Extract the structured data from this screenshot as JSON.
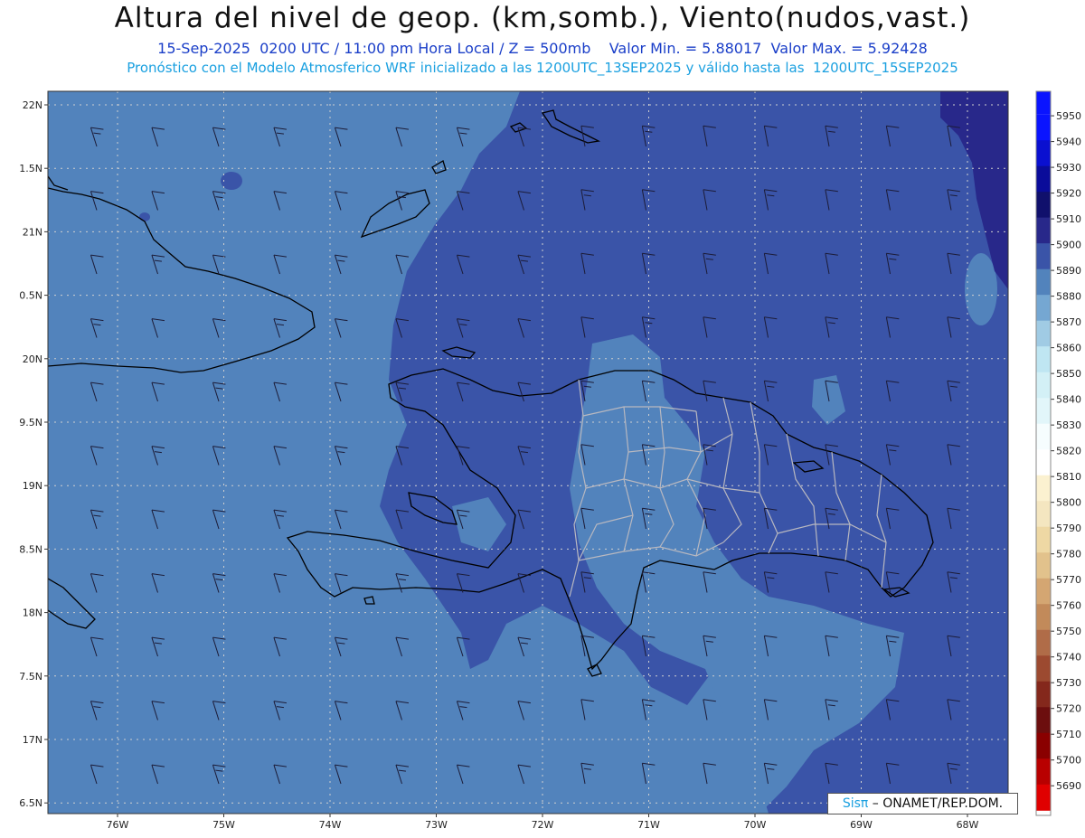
{
  "header": {
    "title": "Altura del nivel de geop. (km,somb.), Viento(nudos,vast.)",
    "subtitle": "15-Sep-2025  0200 UTC / 11:00 pm Hora Local / Z = 500mb    Valor Min. = 5.88017  Valor Max. = 5.92428",
    "model_line": "Pronóstico con el Modelo Atmosferico WRF inicializado a las 1200UTC_13SEP2025 y válido hasta las  1200UTC_15SEP2025"
  },
  "axes": {
    "lat_labels": [
      "22N",
      "1.5N",
      "21N",
      "0.5N",
      "20N",
      "9.5N",
      "19N",
      "8.5N",
      "18N",
      "7.5N",
      "17N",
      "6.5N"
    ],
    "lon_labels": [
      "76W",
      "75W",
      "74W",
      "73W",
      "72W",
      "71W",
      "70W",
      "69W",
      "68W"
    ]
  },
  "colorbar": {
    "labels": [
      "5950",
      "5940",
      "5930",
      "5920",
      "5910",
      "5900",
      "5890",
      "5880",
      "5870",
      "5860",
      "5850",
      "5840",
      "5830",
      "5820",
      "5810",
      "5800",
      "5790",
      "5780",
      "5770",
      "5760",
      "5750",
      "5740",
      "5730",
      "5720",
      "5710",
      "5700",
      "5690"
    ],
    "colors": [
      "#0a14ff",
      "#0a10d0",
      "#0a0c9a",
      "#10106c",
      "#28288a",
      "#3a54a8",
      "#5283bc",
      "#75a7d2",
      "#a0cbe4",
      "#bfe6f2",
      "#d3f0f6",
      "#e2f6fa",
      "#f6fdfe",
      "#ffffff",
      "#fbf1d0",
      "#f4e6c0",
      "#eed8a4",
      "#e2c28c",
      "#d4a672",
      "#c28a5a",
      "#b06c48",
      "#9c4a30",
      "#84281c",
      "#6c0e0e",
      "#8a0000",
      "#b80000",
      "#e00000"
    ]
  },
  "legend": {
    "brand_prefix": "Sisπ",
    "brand_suffix": " – ONAMET/REP.DOM."
  },
  "palette": {
    "ocean_light": "#5283bc",
    "ocean_dark": "#3a54a8",
    "deep": "#28288a",
    "coast": "#000000",
    "provinces": "#b8b8c0",
    "barb": "#1c1c38",
    "grid": "#cfcfcf"
  }
}
